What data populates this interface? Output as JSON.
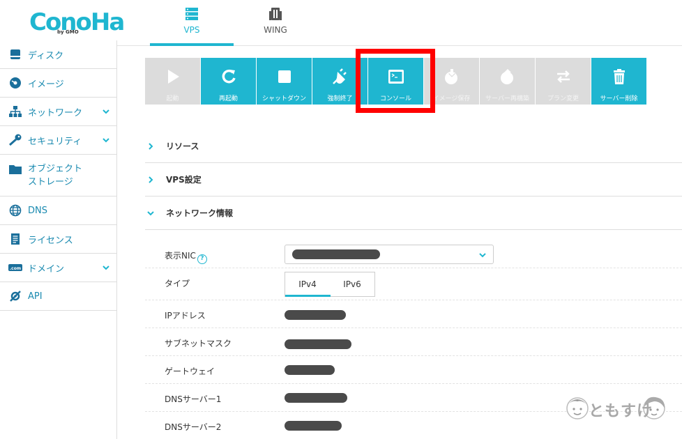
{
  "header": {
    "logo": "ConoHa",
    "logo_by": "by GMO",
    "tabs": [
      {
        "label": "VPS",
        "icon": "server-stack-icon",
        "active": true
      },
      {
        "label": "WING",
        "icon": "building-icon",
        "active": false
      }
    ]
  },
  "sidebar": {
    "items": [
      {
        "label": "ディスク",
        "icon": "disk-icon",
        "has_submenu": false
      },
      {
        "label": "イメージ",
        "icon": "disc-image-icon",
        "has_submenu": false
      },
      {
        "label": "ネットワーク",
        "icon": "network-icon",
        "has_submenu": true
      },
      {
        "label": "セキュリティ",
        "icon": "key-icon",
        "has_submenu": true
      },
      {
        "label": "オブジェクト",
        "label2": "ストレージ",
        "icon": "folder-icon",
        "has_submenu": false
      },
      {
        "label": "DNS",
        "icon": "globe-icon",
        "has_submenu": false
      },
      {
        "label": "ライセンス",
        "icon": "document-icon",
        "has_submenu": false
      },
      {
        "label": "ドメイン",
        "icon": "dotcom-icon",
        "has_submenu": true
      },
      {
        "label": "API",
        "icon": "api-icon",
        "has_submenu": false
      }
    ]
  },
  "toolbar": {
    "buttons": [
      {
        "label": "起動",
        "icon": "play-icon",
        "enabled": false
      },
      {
        "label": "再起動",
        "icon": "restart-icon",
        "enabled": true
      },
      {
        "label": "シャットダウン",
        "icon": "stop-icon",
        "enabled": true
      },
      {
        "label": "強制終了",
        "icon": "plug-icon",
        "enabled": true
      },
      {
        "label": "コンソール",
        "icon": "console-icon",
        "enabled": true
      },
      {
        "label": "イメージ保存",
        "icon": "save-image-icon",
        "enabled": false
      },
      {
        "label": "サーバー再構築",
        "icon": "rebuild-icon",
        "enabled": false
      },
      {
        "label": "プラン変更",
        "icon": "swap-icon",
        "enabled": false
      },
      {
        "label": "サーバー削除",
        "icon": "trash-icon",
        "enabled": true
      }
    ],
    "accent_color": "#1fb6d0",
    "disabled_color": "#dcdcdc",
    "highlight_color": "#ff0000"
  },
  "sections": [
    {
      "title": "リソース",
      "expanded": false
    },
    {
      "title": "VPS設定",
      "expanded": false
    },
    {
      "title": "ネットワーク情報",
      "expanded": true
    }
  ],
  "network_info": {
    "nic_label": "表示NIC",
    "type_label": "タイプ",
    "type_options": [
      "IPv4",
      "IPv6"
    ],
    "type_selected": "IPv4",
    "ip_label": "IPアドレス",
    "subnet_label": "サブネットマスク",
    "gateway_label": "ゲートウェイ",
    "dns1_label": "DNSサーバー1",
    "dns2_label": "DNSサーバー2"
  },
  "watermark": {
    "text": "ともすけ"
  }
}
